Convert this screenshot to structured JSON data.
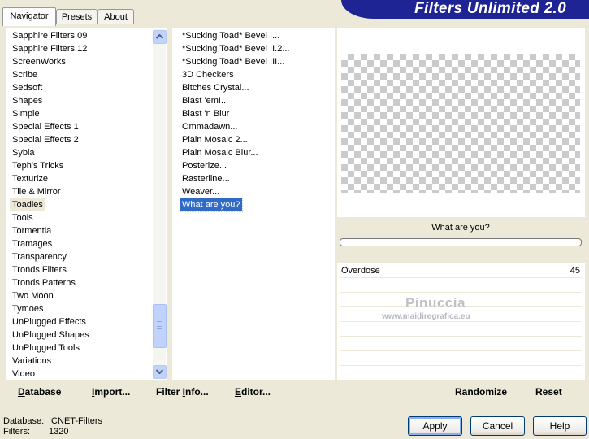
{
  "tabs": [
    {
      "label": "Navigator"
    },
    {
      "label": "Presets"
    },
    {
      "label": "About"
    }
  ],
  "banner": {
    "title": "Filters Unlimited 2.0"
  },
  "categories": [
    "Sapphire Filters 09",
    "Sapphire Filters 12",
    "ScreenWorks",
    "Scribe",
    "Sedsoft",
    "Shapes",
    "Simple",
    "Special Effects 1",
    "Special Effects 2",
    "Sybia",
    "Teph's Tricks",
    "Texturize",
    "Tile & Mirror",
    "Toadies",
    "Tools",
    "Tormentia",
    "Tramages",
    "Transparency",
    "Tronds Filters",
    "Tronds Patterns",
    "Two Moon",
    "Tymoes",
    "UnPlugged Effects",
    "UnPlugged Shapes",
    "UnPlugged Tools",
    "Variations",
    "Video"
  ],
  "selected_category": "Toadies",
  "filters": [
    "*Sucking Toad*  Bevel I...",
    "*Sucking Toad*  Bevel II.2...",
    "*Sucking Toad*  Bevel III...",
    "3D Checkers",
    "Bitches Crystal...",
    "Blast 'em!...",
    "Blast 'n Blur",
    "Ommadawn...",
    "Plain Mosaic 2...",
    "Plain Mosaic Blur...",
    "Posterize...",
    "Rasterline...",
    "Weaver...",
    "What are you?"
  ],
  "selected_filter": "What are you?",
  "preview": {
    "filter_title": "What are you?"
  },
  "params": [
    {
      "name": "Overdose",
      "value": "45"
    }
  ],
  "watermark": {
    "name": "Pinuccia",
    "url": "www.maidiregrafica.eu"
  },
  "left_toolbar": {
    "database": {
      "pre": "",
      "u": "D",
      "post": "atabase"
    },
    "import": {
      "pre": "",
      "u": "I",
      "post": "mport..."
    },
    "filter_info": {
      "pre": "Filter ",
      "u": "I",
      "post": "nfo..."
    },
    "editor": {
      "pre": "",
      "u": "E",
      "post": "ditor..."
    }
  },
  "right_toolbar": {
    "randomize": "Randomize",
    "reset": "Reset"
  },
  "status": {
    "database_label": "Database:",
    "database_value": "ICNET-Filters",
    "filters_label": "Filters:",
    "filters_value": "1320"
  },
  "buttons": {
    "apply": "Apply",
    "cancel": "Cancel",
    "help": "Help"
  }
}
